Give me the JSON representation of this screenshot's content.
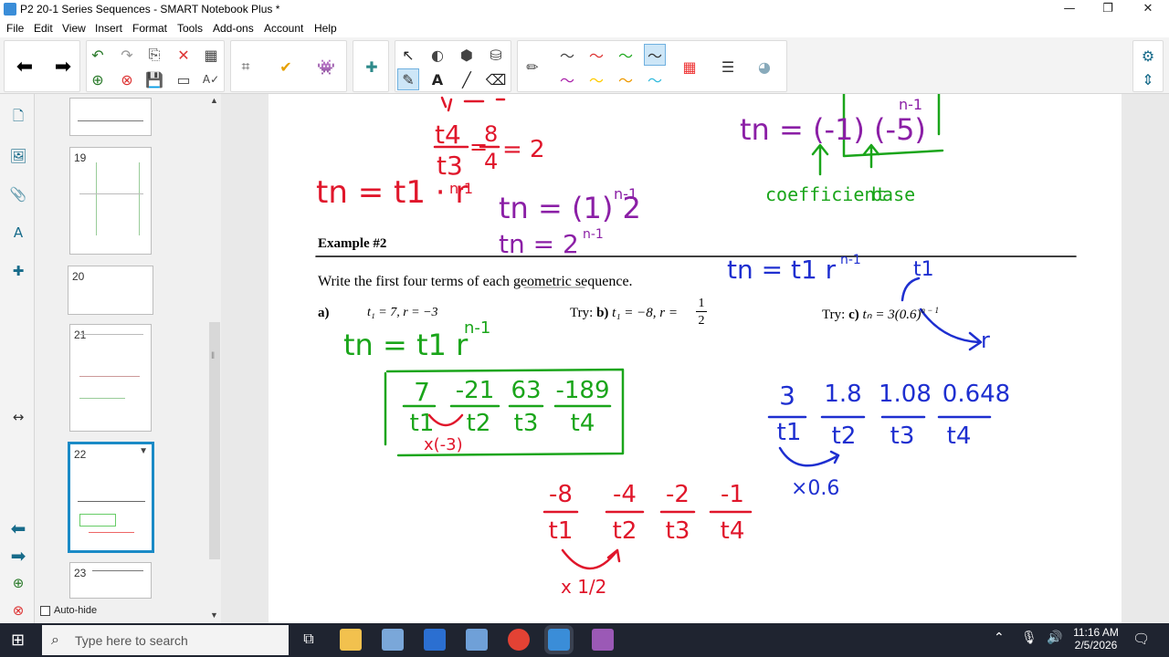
{
  "window": {
    "title": "P2 20-1 Series Sequences - SMART Notebook Plus *",
    "minimize": "—",
    "restore": "❐",
    "close": "✕"
  },
  "menu": [
    "File",
    "Edit",
    "View",
    "Insert",
    "Format",
    "Tools",
    "Add-ons",
    "Account",
    "Help"
  ],
  "sorter": {
    "pages": [
      {
        "num": "19"
      },
      {
        "num": "20"
      },
      {
        "num": "21"
      },
      {
        "num": "22"
      },
      {
        "num": "23"
      }
    ],
    "autohide_label": "Auto-hide"
  },
  "slide": {
    "example_heading": "Example #2",
    "instruction_pre": "Write the first four terms of each ",
    "instruction_link": "geometric",
    "instruction_post": " sequence.",
    "problem_a_label": "a)",
    "problem_a_text": "t₁ = 7, r = −3",
    "problem_b_prefix": "Try:",
    "problem_b_label": "b)",
    "problem_b_text": "t₁ = −8, r =",
    "problem_b_num": "1",
    "problem_b_den": "2",
    "problem_c_prefix": "Try:",
    "problem_c_label": "c)",
    "problem_c_text": "tₙ = 3(0.6)",
    "problem_c_exp": "n − 1",
    "ink": {
      "top_left_ratio": "t₄/t₃ = 8/4 = 2",
      "r_num": "t4",
      "r_den": "t3",
      "frac_num": "8",
      "frac_den": "4",
      "eq_result": "= 2",
      "general_red": "tn = t1 · r",
      "general_red_exp": "n-1",
      "purple_1": "tn = (1) 2",
      "purple_1_exp": "n-1",
      "purple_2": "tn = 2",
      "purple_2_exp": "n-1",
      "purple_top": "tn = (-1) (-5)",
      "purple_top_exp": "n-1",
      "coefficient_label": "coefficient",
      "base_label": "base",
      "blue_general": "tn = t1 r",
      "blue_general_exp": "n-1",
      "blue_t1": "t1",
      "blue_r": "r",
      "green_general": "tn = t1 r",
      "green_general_exp": "n-1",
      "green_terms": [
        "7",
        "-21",
        "63",
        "-189"
      ],
      "green_labels": [
        "t1",
        "t2",
        "t3",
        "t4"
      ],
      "green_mult": "x(-3)",
      "red_terms": [
        "-8",
        "-4",
        "-2",
        "-1"
      ],
      "red_labels": [
        "t1",
        "t2",
        "t3",
        "t4"
      ],
      "red_mult": "x 1/2",
      "blue_terms": [
        "3",
        "1.8",
        "1.08",
        "0.648"
      ],
      "blue_labels": [
        "t1",
        "t2",
        "t3",
        "t4"
      ],
      "blue_mult": "×0.6"
    }
  },
  "taskbar": {
    "search_placeholder": "Type here to search",
    "time": "11:16 AM",
    "date": "2/5/2026"
  },
  "colors": {
    "green_ink": "#1aa51a",
    "red_ink": "#e0162b",
    "purple_ink": "#8b1fa6",
    "blue_ink": "#1e2fd0",
    "accent": "#1a8ac6"
  }
}
